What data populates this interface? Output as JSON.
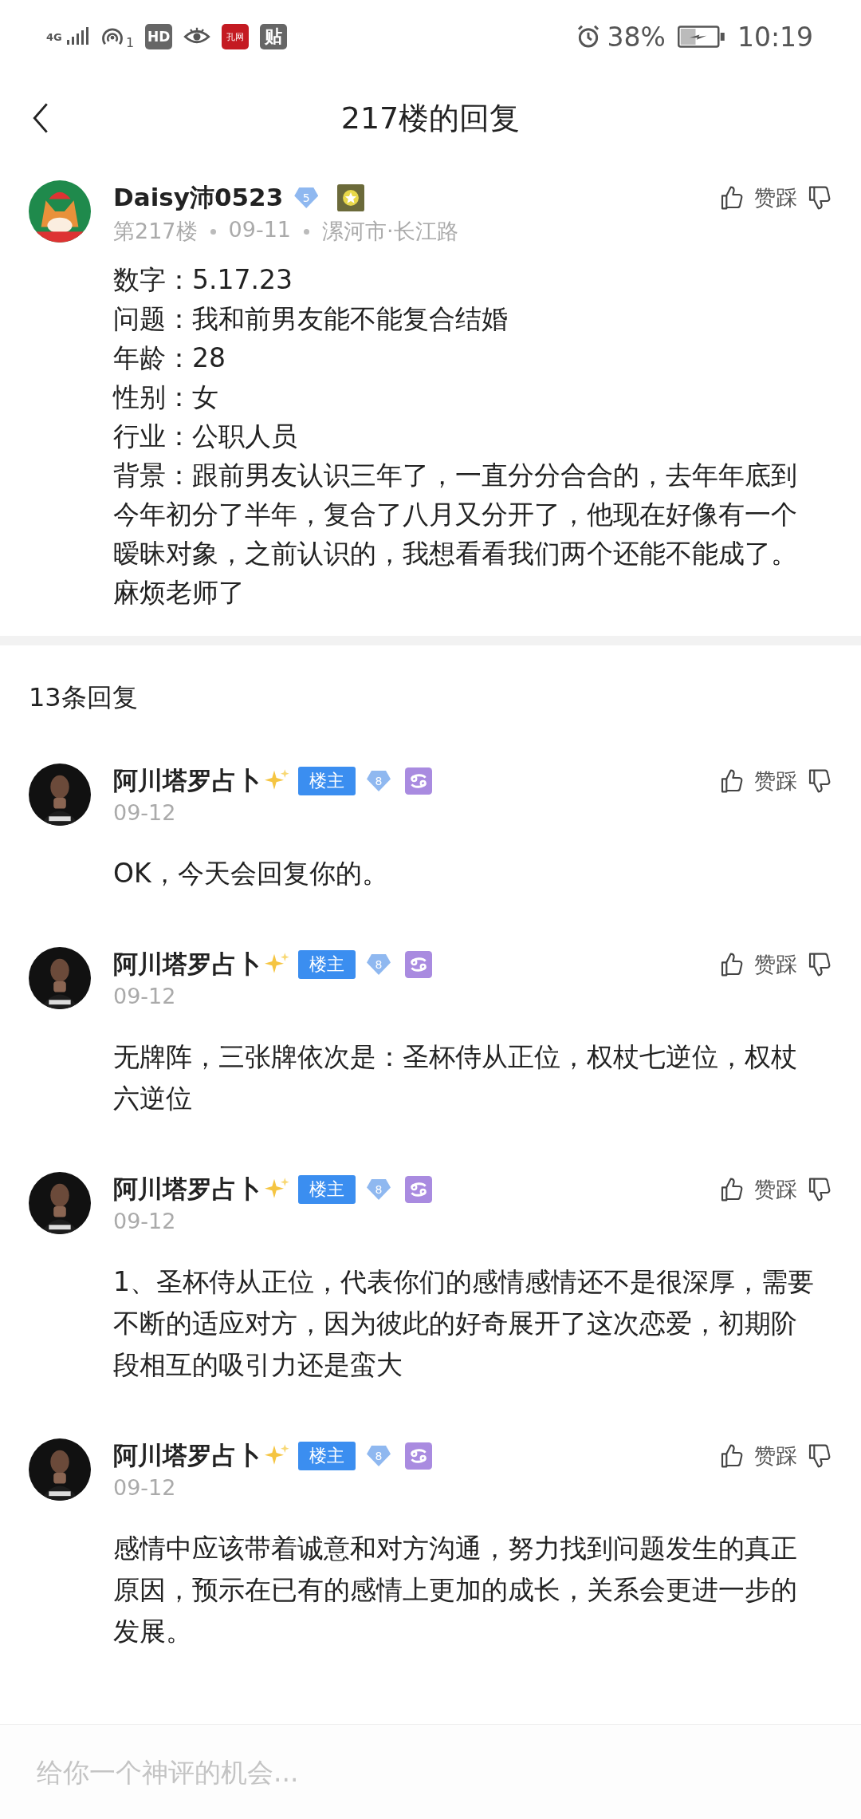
{
  "status_bar": {
    "network": "4G",
    "hotspot_count": "1",
    "hd_icon": "HD",
    "red_app": "孔网",
    "tieba_app": "贴",
    "battery": "38%",
    "time": "10:19"
  },
  "header": {
    "title": "217楼的回复"
  },
  "post": {
    "author": "Daisy沛0523",
    "level": "5",
    "floor": "第217楼",
    "date": "09-11",
    "location": "漯河市·长江路",
    "vote_label": "赞踩",
    "lines": [
      "数字：5.17.23",
      "问题：我和前男友能不能复合结婚",
      "年龄：28",
      "性别：女",
      "行业：公职人员",
      "背景：跟前男友认识三年了，一直分分合合的，去年年底到今年初分了半年，复合了八月又分开了，他现在好像有一个暧昧对象，之前认识的，我想看看我们两个还能不能成了。麻烦老师了"
    ]
  },
  "reply_count": "13条回复",
  "replies": [
    {
      "author": "阿川塔罗占卜",
      "owner_badge": "楼主",
      "level": "8",
      "date": "09-12",
      "vote_label": "赞踩",
      "text": "OK，今天会回复你的。"
    },
    {
      "author": "阿川塔罗占卜",
      "owner_badge": "楼主",
      "level": "8",
      "date": "09-12",
      "vote_label": "赞踩",
      "text": "无牌阵，三张牌依次是：圣杯侍从正位，权杖七逆位，权杖六逆位"
    },
    {
      "author": "阿川塔罗占卜",
      "owner_badge": "楼主",
      "level": "8",
      "date": "09-12",
      "vote_label": "赞踩",
      "text": "1、圣杯侍从正位，代表你们的感情感情还不是很深厚，需要不断的适应对方，因为彼此的好奇展开了这次恋爱，初期阶段相互的吸引力还是蛮大"
    },
    {
      "author": "阿川塔罗占卜",
      "owner_badge": "楼主",
      "level": "8",
      "date": "09-12",
      "vote_label": "赞踩",
      "text": "感情中应该带着诚意和对方沟通，努力找到问题发生的真正原因，预示在已有的感情上更加的成长，关系会更进一步的发展。"
    }
  ],
  "comment_bar": {
    "placeholder": "给你一个神评的机会..."
  }
}
